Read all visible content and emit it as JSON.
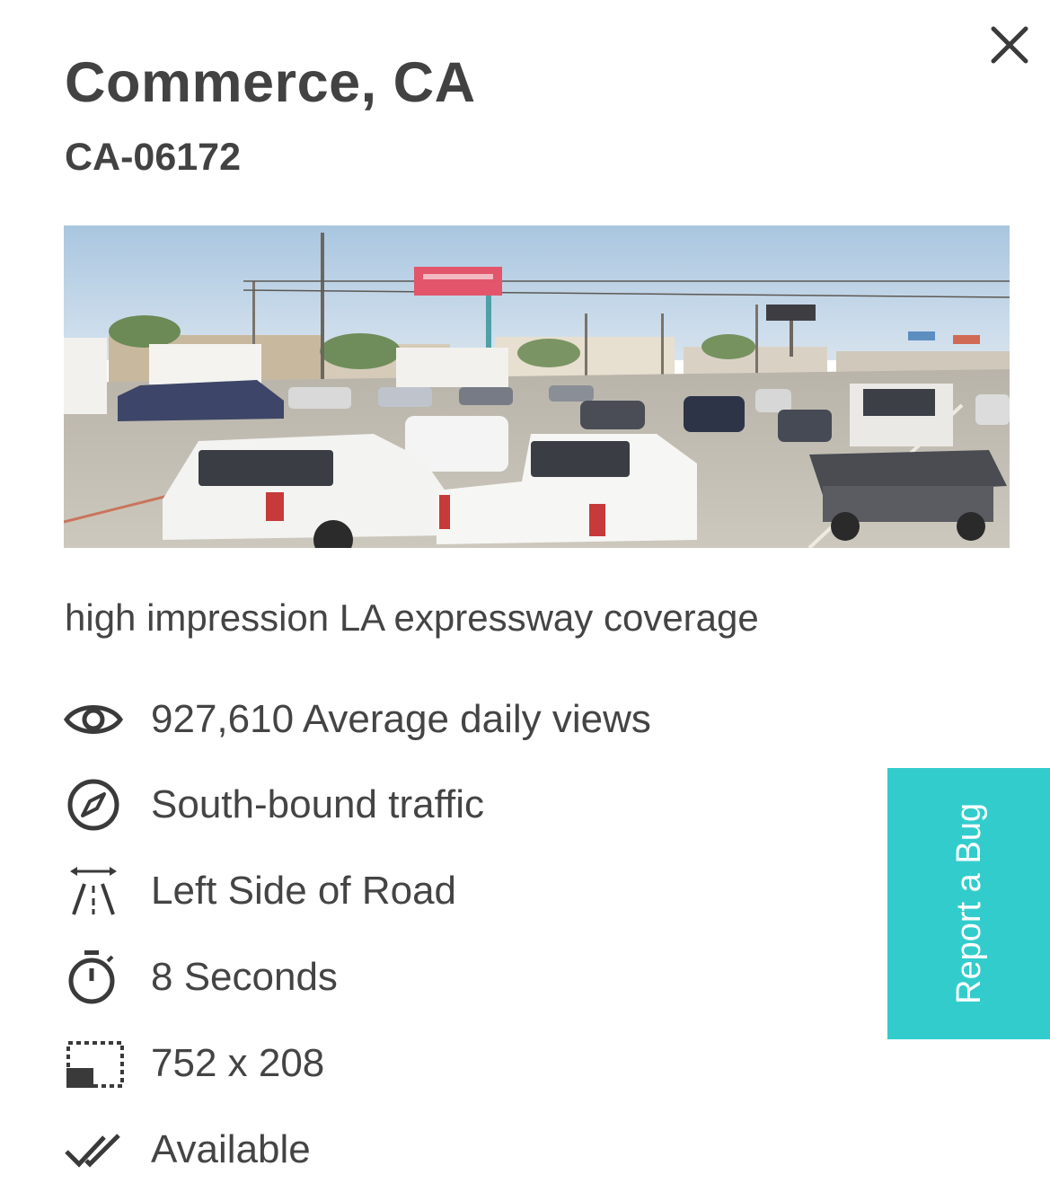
{
  "panel": {
    "title": "Commerce, CA",
    "code": "CA-06172",
    "description": "high impression LA expressway coverage",
    "close_icon": "close-icon"
  },
  "photo": {
    "alt": "Freeway traffic with billboard",
    "billboard_color": "#e2556b"
  },
  "features": [
    {
      "icon": "eye-icon",
      "text": "927,610 Average daily views"
    },
    {
      "icon": "compass-icon",
      "text": "South-bound traffic"
    },
    {
      "icon": "road-side-icon",
      "text": "Left Side of Road"
    },
    {
      "icon": "stopwatch-icon",
      "text": "8 Seconds"
    },
    {
      "icon": "dimensions-icon",
      "text": "752 x 208"
    },
    {
      "icon": "double-check-icon",
      "text": "Available"
    }
  ],
  "report_bug": {
    "label": "Report a Bug",
    "color": "#33cccc"
  }
}
